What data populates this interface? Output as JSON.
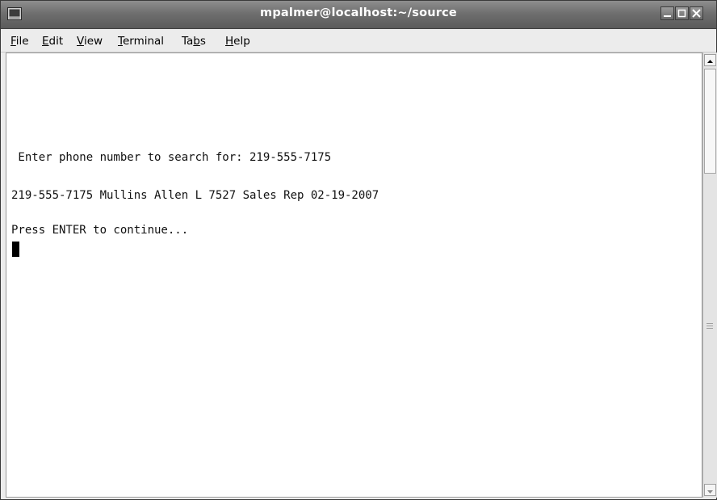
{
  "window": {
    "title": "mpalmer@localhost:~/source",
    "app_icon": "terminal-icon",
    "controls": [
      "minimize-icon",
      "maximize-icon",
      "close-icon"
    ]
  },
  "menubar": {
    "items": [
      {
        "label": "File",
        "mnemonic": "F"
      },
      {
        "label": "Edit",
        "mnemonic": "E"
      },
      {
        "label": "View",
        "mnemonic": "V"
      },
      {
        "label": "Terminal",
        "mnemonic": "T"
      },
      {
        "label": "Tabs",
        "mnemonic": "b"
      },
      {
        "label": "Help",
        "mnemonic": "H"
      }
    ]
  },
  "terminal": {
    "lines": [
      " Enter phone number to search for: 219-555-7175",
      "219-555-7175 Mullins Allen L 7527 Sales Rep 02-19-2007",
      "Press ENTER to continue..."
    ]
  },
  "scrollbar": {
    "up_icon": "scroll-up-arrow-icon",
    "down_icon": "scroll-down-arrow-icon"
  }
}
